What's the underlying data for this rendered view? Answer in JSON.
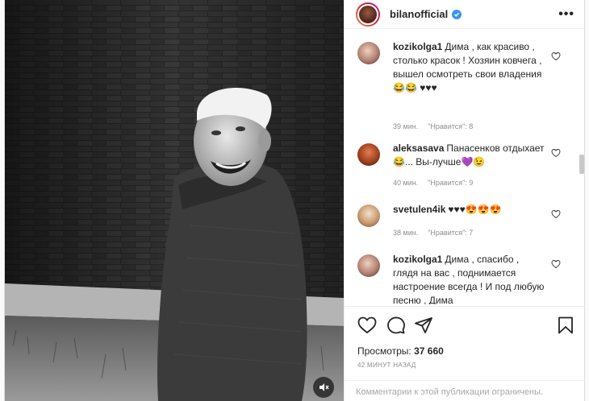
{
  "post": {
    "username": "bilanofficial",
    "more_label": "•••",
    "mute_icon": "speaker-muted-icon",
    "views_label": "Просмотры:",
    "views_value": "37 660",
    "posted_ago": "42 минут назад",
    "comments_disabled": "Комментарии к этой публикации ограничены."
  },
  "comments": [
    {
      "user": "kozikolga1",
      "text": "Дима , как красиво , столько красок ! Хозяин ковчега , вышел осмотреть свои владения 😂😂 ♥♥♥",
      "time": "39 мин.",
      "likes": "\"Нравится\": 8"
    },
    {
      "user": "aleksasava",
      "text": "Панасенков отдыхает😂... Вы-лучше💜😉",
      "time": "40 мин.",
      "likes": "\"Нравится\": 9"
    },
    {
      "user": "svetulen4ik",
      "text": "♥♥♥😍😍😍",
      "time": "38 мин.",
      "likes": "\"Нравится\": 7"
    },
    {
      "user": "kozikolga1",
      "text": "Дима , спасибо , глядя на вас , поднимается настроение всегда ! И под любую песню , Дима",
      "time": "",
      "likes": ""
    }
  ],
  "colors": {
    "verified": "#3897f0",
    "heart_red": "#ed4956",
    "muted_text": "#8e8e8e"
  }
}
